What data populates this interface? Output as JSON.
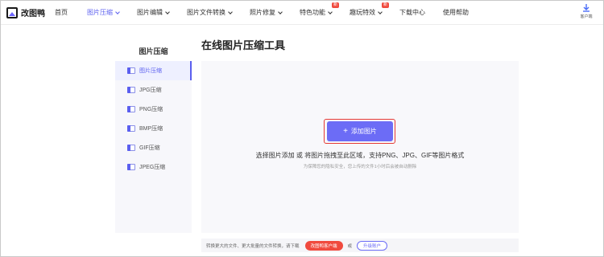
{
  "app": {
    "name": "改图鸭"
  },
  "nav": {
    "items": [
      {
        "label": "首页",
        "active": false,
        "dropdown": false,
        "badge": ""
      },
      {
        "label": "图片压缩",
        "active": true,
        "dropdown": true,
        "badge": ""
      },
      {
        "label": "图片编辑",
        "active": false,
        "dropdown": true,
        "badge": ""
      },
      {
        "label": "图片文件转换",
        "active": false,
        "dropdown": true,
        "badge": ""
      },
      {
        "label": "照片修复",
        "active": false,
        "dropdown": true,
        "badge": ""
      },
      {
        "label": "特色功能",
        "active": false,
        "dropdown": true,
        "badge": "新"
      },
      {
        "label": "趣玩特效",
        "active": false,
        "dropdown": true,
        "badge": "新"
      },
      {
        "label": "下载中心",
        "active": false,
        "dropdown": false,
        "badge": ""
      },
      {
        "label": "使用帮助",
        "active": false,
        "dropdown": false,
        "badge": ""
      }
    ],
    "client_download": "客户端"
  },
  "sidebar": {
    "title": "图片压缩",
    "items": [
      {
        "label": "图片压缩",
        "active": true
      },
      {
        "label": "JPG压缩",
        "active": false
      },
      {
        "label": "PNG压缩",
        "active": false
      },
      {
        "label": "BMP压缩",
        "active": false
      },
      {
        "label": "GIF压缩",
        "active": false
      },
      {
        "label": "JPEG压缩",
        "active": false
      }
    ]
  },
  "main": {
    "title": "在线图片压缩工具",
    "add_button": "添加图片",
    "hint": "选择图片添加 或 将图片拖拽至此区域，支持PNG、JPG、GIF等图片格式",
    "subhint": "为保障您的隐私安全，您上传的文件1小时后会被自动删除"
  },
  "bottom": {
    "text": "转换更大的文件、更大批量的文件转换，请下载",
    "vip_button": "改图鸭客户端",
    "or": "或",
    "upgrade_button": "升级账户"
  },
  "colors": {
    "accent": "#6c6cf6",
    "nav_active": "#5b5fef",
    "badge": "#f04a3e"
  }
}
